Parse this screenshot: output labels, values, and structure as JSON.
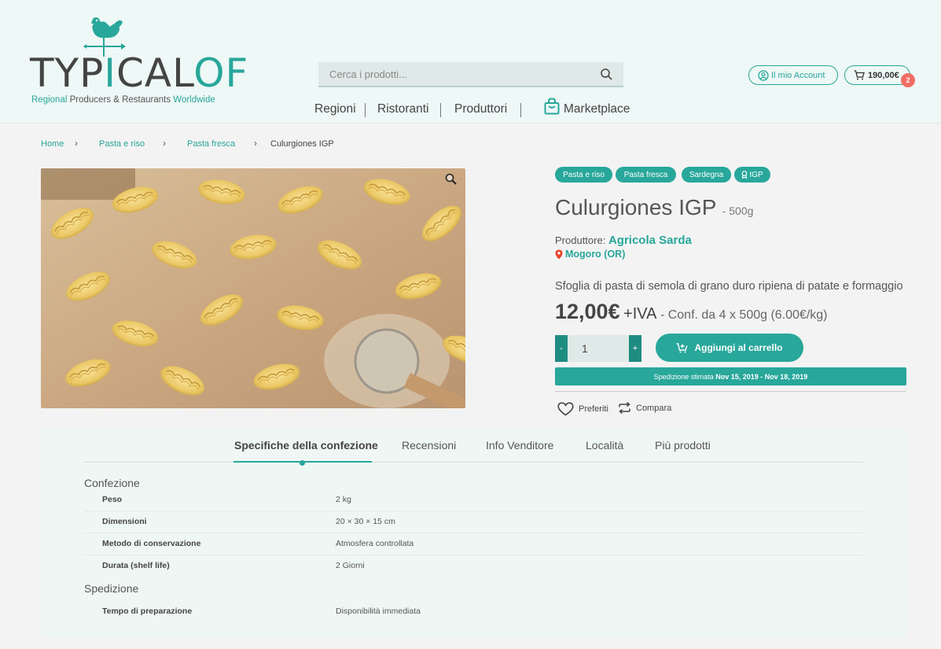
{
  "header": {
    "logo": {
      "part1": "TYP",
      "part2": "I",
      "part3": "CAL",
      "part4": "OF",
      "subtitle_1": "Regional",
      "subtitle_2": "Producers & Restaurants",
      "subtitle_3": "Worldwide"
    },
    "search": {
      "placeholder": "Cerca i prodotti..."
    },
    "nav": [
      "Regioni",
      "Ristoranti",
      "Produttori",
      "Marketplace"
    ],
    "account_label": "Il mio Account",
    "cart_total": "190,00€",
    "cart_count": "2"
  },
  "breadcrumb": [
    "Home",
    "Pasta e riso",
    "Pasta fresca",
    "Culurgiones IGP"
  ],
  "product": {
    "tags": [
      "Pasta e riso",
      "Pasta fresca",
      "Sardegna",
      "IGP"
    ],
    "title": "Culurgiones IGP",
    "weight": "- 500g",
    "producer_label": "Produttore:",
    "producer_name": "Agricola Sarda",
    "location": "Mogoro (OR)",
    "description": "Sfoglia di pasta di semola di grano duro ripiena di patate e formaggio",
    "price": "12,00€",
    "iva": "+IVA",
    "conf": "- Conf. da 4 x 500g (6.00€/kg)",
    "qty_minus": "-",
    "qty_value": "1",
    "qty_plus": "+",
    "add_to_cart": "Aggiungi al carrello",
    "shipping_label": "Spedizione stimata",
    "shipping_dates": "Nov 15, 2019 - Nov 18, 2019",
    "favorites": "Preferiti",
    "compare": "Compara"
  },
  "tabs": [
    "Specifiche della confezione",
    "Recensioni",
    "Info Venditore",
    "Località",
    "Più prodotti"
  ],
  "specs": {
    "confezione_title": "Confezione",
    "confezione": [
      {
        "label": "Peso",
        "value": "2 kg"
      },
      {
        "label": "Dimensioni",
        "value": "20 × 30 × 15 cm"
      },
      {
        "label": "Metodo di conservazione",
        "value": "Atmosfera controllata"
      },
      {
        "label": "Durata (shelf life)",
        "value": "2 Giorni"
      }
    ],
    "spedizione_title": "Spedizione",
    "spedizione": [
      {
        "label": "Tempo di preparazione",
        "value": "Disponibilità immediata"
      }
    ]
  },
  "colors": {
    "accent": "#28a79b",
    "accent_dark": "#1f8c82",
    "badge": "#f26d63",
    "header_bg": "#eef8f6"
  }
}
